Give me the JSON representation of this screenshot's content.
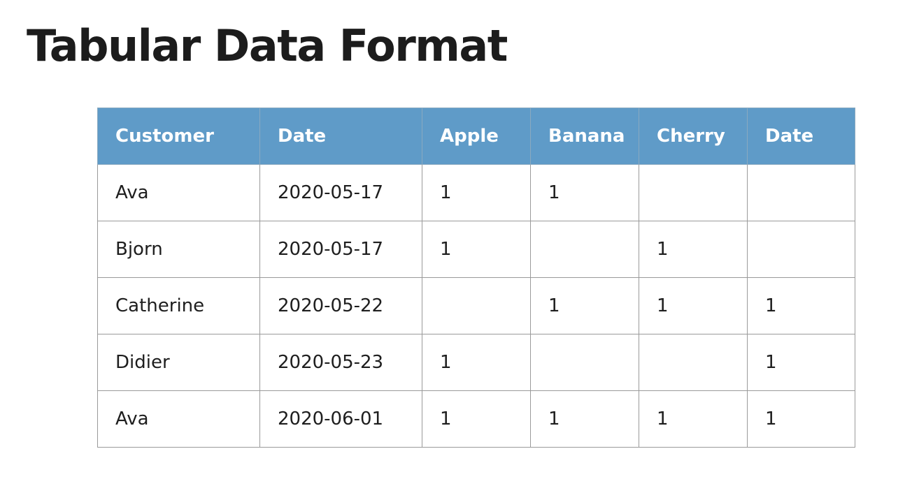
{
  "slide": {
    "title": "Tabular Data Format"
  },
  "table": {
    "headers": [
      "Customer",
      "Date",
      "Apple",
      "Banana",
      "Cherry",
      "Date"
    ],
    "rows": [
      [
        "Ava",
        "2020-05-17",
        "1",
        "1",
        "",
        ""
      ],
      [
        "Bjorn",
        "2020-05-17",
        "1",
        "",
        "1",
        ""
      ],
      [
        "Catherine",
        "2020-05-22",
        "",
        "1",
        "1",
        "1"
      ],
      [
        "Didier",
        "2020-05-23",
        "1",
        "",
        "",
        "1"
      ],
      [
        "Ava",
        "2020-06-01",
        "1",
        "1",
        "1",
        "1"
      ]
    ]
  },
  "colors": {
    "header_background": "#5f9bc8",
    "header_text": "#ffffff",
    "title_text": "#1c1c1c",
    "cell_text": "#1e1e1e",
    "grid_border": "#9a9a9a"
  }
}
